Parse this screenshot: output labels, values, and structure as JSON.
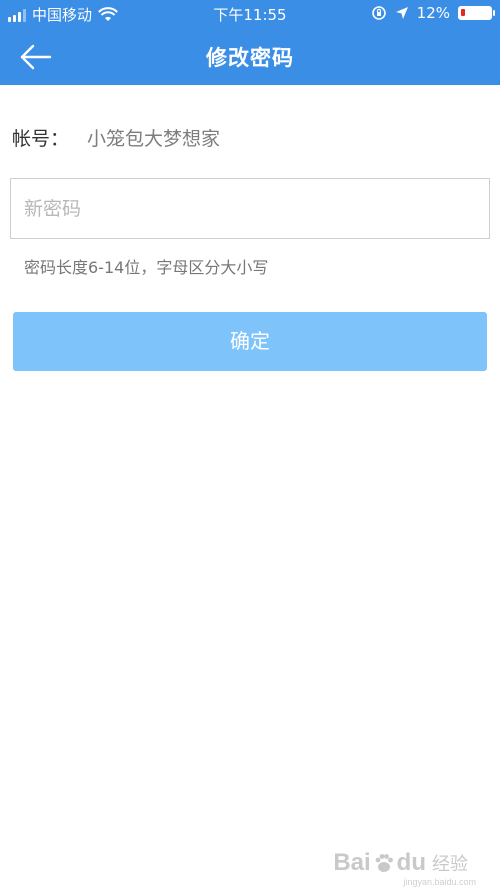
{
  "status_bar": {
    "carrier": "中国移动",
    "time": "下午11:55",
    "battery_percent": "12%",
    "icons": [
      "signal-icon",
      "wifi-icon",
      "orientation-lock-icon",
      "location-icon",
      "battery-icon"
    ],
    "battery_level": 0.12,
    "battery_color": "#e8242b"
  },
  "nav": {
    "title": "修改密码",
    "back_icon": "back-arrow-icon"
  },
  "account": {
    "label": "帐号：",
    "value": "小笼包大梦想家"
  },
  "new_password": {
    "placeholder": "新密码",
    "value": ""
  },
  "hint": "密码长度6-14位，字母区分大小写",
  "confirm_label": "确定",
  "colors": {
    "header_bg": "#3a8ee6",
    "button_bg": "#7fc3fb"
  },
  "watermark": {
    "text": "Bai",
    "text2": "du",
    "cn": "经验",
    "url": "jingyan.baidu.com"
  }
}
